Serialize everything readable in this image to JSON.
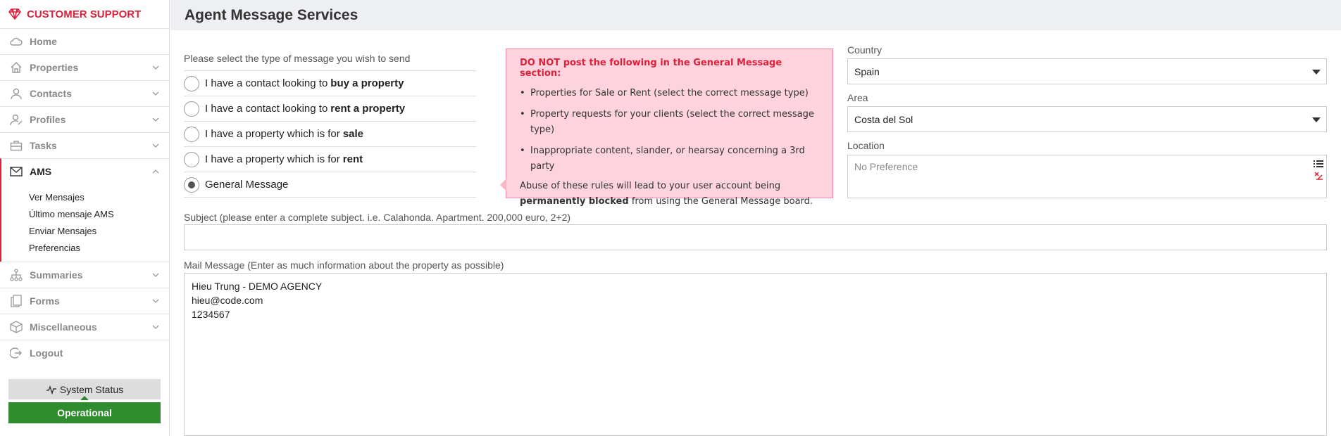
{
  "sidebar": {
    "brand": "CUSTOMER SUPPORT",
    "items": [
      {
        "label": "Home",
        "icon": "cloud-icon"
      },
      {
        "label": "Properties",
        "icon": "house-icon"
      },
      {
        "label": "Contacts",
        "icon": "person-icon"
      },
      {
        "label": "Profiles",
        "icon": "profiles-icon"
      },
      {
        "label": "Tasks",
        "icon": "briefcase-icon"
      },
      {
        "label": "AMS",
        "icon": "envelope-icon"
      },
      {
        "label": "Summaries",
        "icon": "sitemap-icon"
      },
      {
        "label": "Forms",
        "icon": "forms-icon"
      },
      {
        "label": "Miscellaneous",
        "icon": "box-icon"
      },
      {
        "label": "Logout",
        "icon": "logout-icon"
      }
    ],
    "ams_submenu": [
      "Ver Mensajes",
      "Último mensaje AMS",
      "Enviar Mensajes",
      "Preferencias"
    ],
    "system_status": "System Status",
    "status_value": "Operational"
  },
  "header": {
    "title": "Agent Message Services"
  },
  "main": {
    "prompt": "Please select the type of message you wish to send",
    "options": [
      {
        "prefix": "I have a contact looking to",
        "bold": "buy a property",
        "checked": false
      },
      {
        "prefix": "I have a contact looking to",
        "bold": "rent a property",
        "checked": false
      },
      {
        "prefix": "I have a property which is for",
        "bold": "sale",
        "checked": false
      },
      {
        "prefix": "I have a property which is for",
        "bold": "rent",
        "checked": false
      },
      {
        "prefix": "General Message",
        "bold": "",
        "checked": true
      }
    ],
    "warning": {
      "title": "DO NOT post the following in the General Message section:",
      "bullets": [
        "Properties for Sale or Rent (select the correct message type)",
        "Property requests for your clients (select the correct message type)",
        "Inappropriate content, slander, or hearsay concerning a 3rd party"
      ],
      "abuse_prefix": "Abuse of these rules will lead to your user account being",
      "abuse_bold": "permanently blocked",
      "abuse_suffix": "from using the General Message board."
    },
    "country_label": "Country",
    "country_value": "Spain",
    "area_label": "Area",
    "area_value": "Costa del Sol",
    "location_label": "Location",
    "location_placeholder": "No Preference",
    "subject_label": "Subject (please enter a complete subject. i.e. Calahonda. Apartment. 200,000 euro, 2+2)",
    "subject_value": "",
    "message_label": "Mail Message (Enter as much information about the property as possible)",
    "message_lines": [
      "Hieu Trung - DEMO AGENCY",
      "hieu@code.com",
      "1234567"
    ]
  },
  "colors": {
    "brand_red": "#e0203a",
    "operational_green": "#2e8b2e",
    "warning_bg": "#fdd3dd"
  }
}
